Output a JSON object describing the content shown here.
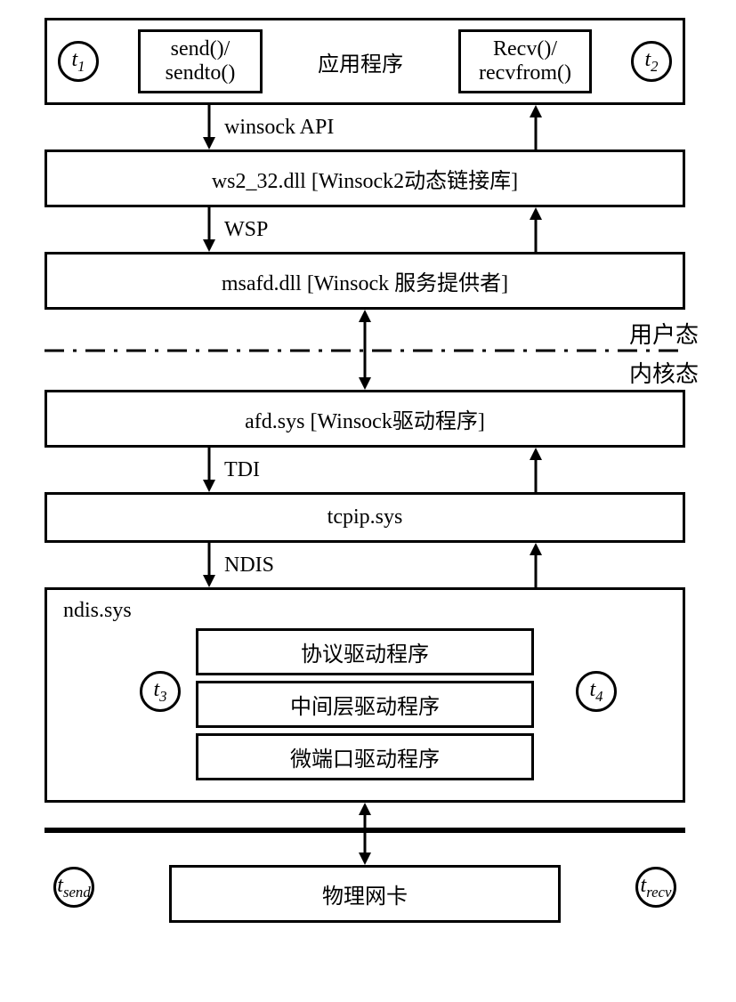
{
  "app": {
    "t1": "t",
    "t1_sub": "1",
    "t2": "t",
    "t2_sub": "2",
    "send_box": "send()/\nsendto()",
    "recv_box": "Recv()/\nrecvfrom()",
    "title": "应用程序"
  },
  "arrows": {
    "winsock_api": "winsock API",
    "wsp": "WSP",
    "tdi": "TDI",
    "ndis": "NDIS"
  },
  "layers": {
    "ws2_32": "ws2_32.dll  [Winsock2动态链接库]",
    "msafd": "msafd.dll [Winsock 服务提供者]",
    "afd": "afd.sys [Winsock驱动程序]",
    "tcpip": "tcpip.sys",
    "ndis_title": "ndis.sys",
    "ndis_proto": "协议驱动程序",
    "ndis_mid": "中间层驱动程序",
    "ndis_mini": "微端口驱动程序",
    "nic": "物理网卡"
  },
  "modes": {
    "user": "用户态",
    "kernel": "内核态"
  },
  "ndis_circles": {
    "t3": "t",
    "t3_sub": "3",
    "t4": "t",
    "t4_sub": "4"
  },
  "nic_circles": {
    "tsend": "t",
    "tsend_sub": "send",
    "trecv": "t",
    "trecv_sub": "recv"
  }
}
